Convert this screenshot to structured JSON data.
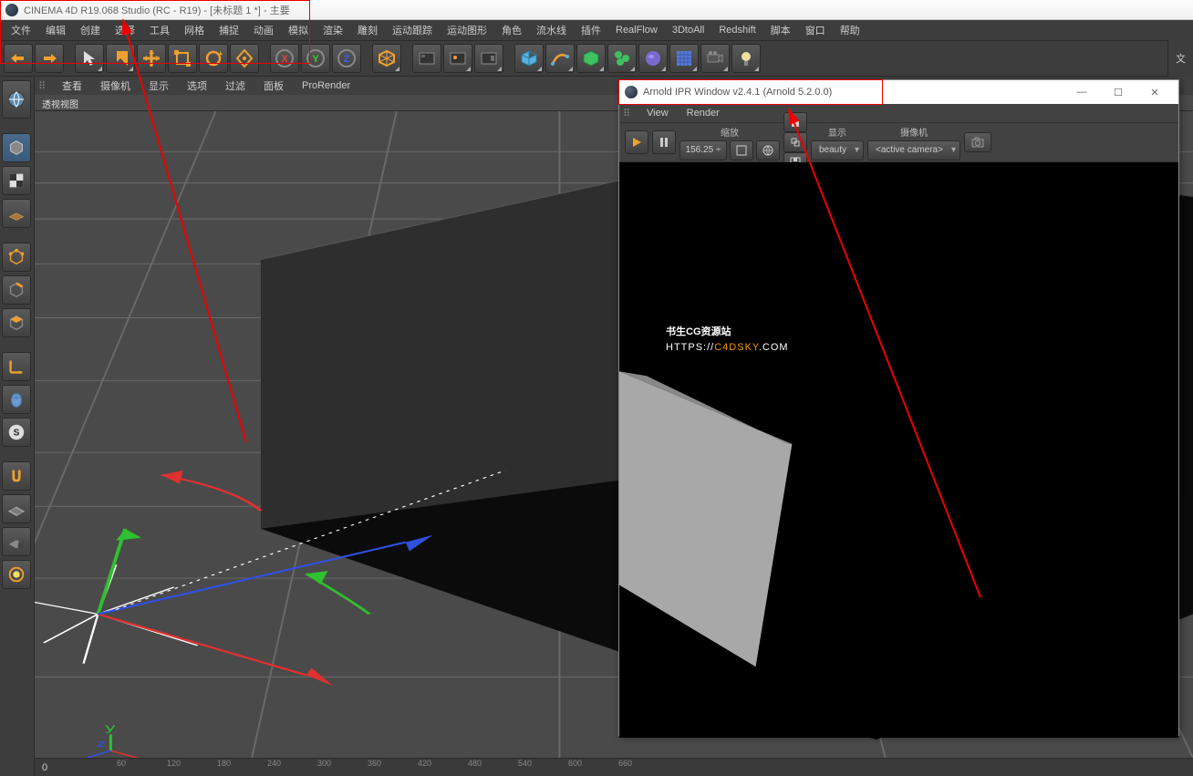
{
  "title": "CINEMA 4D R19.068 Studio (RC - R19) - [未标题 1 *] - 主要",
  "menu": [
    "文件",
    "编辑",
    "创建",
    "选择",
    "工具",
    "网格",
    "捕捉",
    "动画",
    "模拟",
    "渲染",
    "雕刻",
    "运动跟踪",
    "运动图形",
    "角色",
    "流水线",
    "插件",
    "RealFlow",
    "3DtoAll",
    "Redshift",
    "脚本",
    "窗口",
    "帮助"
  ],
  "rside_label": "文",
  "viewport": {
    "menu": [
      "查看",
      "摄像机",
      "显示",
      "选项",
      "过滤",
      "面板",
      "ProRender"
    ],
    "label": "透视视图",
    "frame": "0",
    "ticks": [
      "60",
      "120",
      "180",
      "240",
      "300",
      "360",
      "420",
      "480",
      "540",
      "600",
      "660"
    ]
  },
  "arnold": {
    "title": "Arnold IPR Window v2.4.1 (Arnold 5.2.0.0)",
    "menu": [
      "View",
      "Render"
    ],
    "zoom_label": "缩放",
    "zoom_value": "156.25 ÷",
    "display_label": "显示",
    "display_value": "beauty",
    "camera_label": "摄像机",
    "camera_value": "<active camera>"
  },
  "watermark": {
    "main": "书生CG资源站",
    "sub_pre": "HTTPS://",
    "sub_hi": "C4DSKY",
    "sub_post": ".COM"
  }
}
